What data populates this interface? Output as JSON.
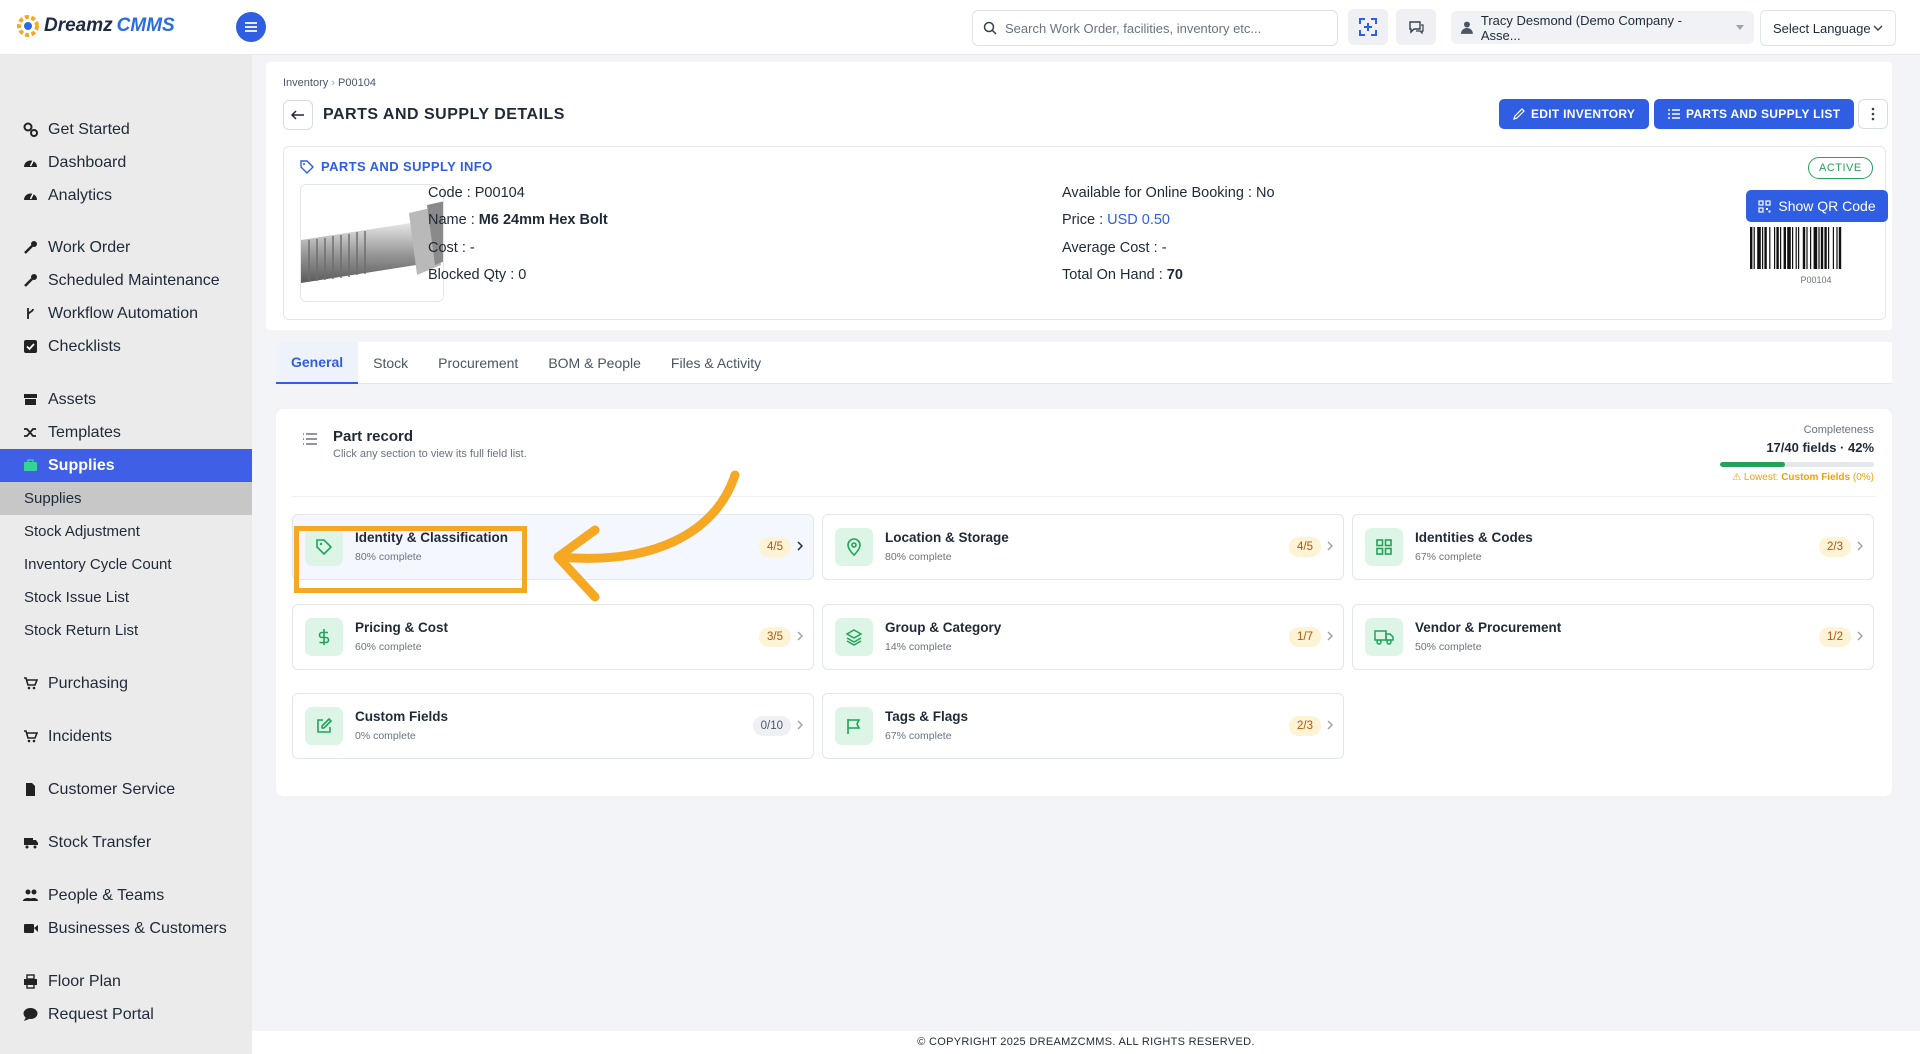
{
  "app": {
    "logo_part1": "Dreamz",
    "logo_part2": "CMMS"
  },
  "header": {
    "search_placeholder": "Search Work Order, facilities, inventory etc...",
    "user_name": "Tracy Desmond (Demo Company - Asse...",
    "language_label": "Select Language"
  },
  "sidebar": {
    "items": [
      {
        "label": "Get Started",
        "icon": "gears-icon"
      },
      {
        "label": "Dashboard",
        "icon": "gauge-icon"
      },
      {
        "label": "Analytics",
        "icon": "gauge-icon"
      },
      {
        "label": "Work Order",
        "icon": "wrench-icon"
      },
      {
        "label": "Scheduled Maintenance",
        "icon": "wrench-icon"
      },
      {
        "label": "Workflow Automation",
        "icon": "branch-icon"
      },
      {
        "label": "Checklists",
        "icon": "checkbox-icon"
      },
      {
        "label": "Assets",
        "icon": "archive-icon"
      },
      {
        "label": "Templates",
        "icon": "shuffle-icon"
      },
      {
        "label": "Supplies",
        "icon": "briefcase-icon"
      },
      {
        "label": "Purchasing",
        "icon": "cart-icon"
      },
      {
        "label": "Incidents",
        "icon": "cart-icon"
      },
      {
        "label": "Customer Service",
        "icon": "file-icon"
      },
      {
        "label": "Stock Transfer",
        "icon": "truck-icon"
      },
      {
        "label": "People & Teams",
        "icon": "users-icon"
      },
      {
        "label": "Businesses & Customers",
        "icon": "video-icon"
      },
      {
        "label": "Floor Plan",
        "icon": "printer-icon"
      },
      {
        "label": "Request Portal",
        "icon": "chat-icon"
      }
    ],
    "sub_items": [
      "Supplies",
      "Stock Adjustment",
      "Inventory Cycle Count",
      "Stock Issue List",
      "Stock Return List"
    ]
  },
  "page": {
    "breadcrumb_root": "Inventory",
    "breadcrumb_current": "P00104",
    "title": "PARTS AND SUPPLY DETAILS",
    "edit_button": "EDIT INVENTORY",
    "list_button": "PARTS AND SUPPLY LIST"
  },
  "info": {
    "section_title": "PARTS AND SUPPLY INFO",
    "code_label": "Code :",
    "code_value": "P00104",
    "name_label": "Name :",
    "name_value": "M6 24mm Hex Bolt",
    "cost_label": "Cost :",
    "cost_value": "-",
    "blocked_label": "Blocked Qty :",
    "blocked_value": "0",
    "online_label": "Available for Online Booking :",
    "online_value": "No",
    "price_label": "Price :",
    "price_value": "USD 0.50",
    "avg_label": "Average Cost :",
    "avg_value": "-",
    "onhand_label": "Total On Hand :",
    "onhand_value": "70",
    "status": "ACTIVE",
    "qr_button": "Show QR Code",
    "barcode_text": "P00104"
  },
  "tabs": [
    "General",
    "Stock",
    "Procurement",
    "BOM & People",
    "Files & Activity"
  ],
  "record": {
    "title": "Part record",
    "subtitle": "Click any section to view its full field list.",
    "completeness_label": "Completeness",
    "completeness_value": "17/40 fields · 42%",
    "completeness_pct": 42,
    "lowest_prefix": "⚠ Lowest:",
    "lowest_name": "Custom Fields",
    "lowest_pct": "(0%)",
    "sections": [
      {
        "name": "Identity & Classification",
        "pct": "80% complete",
        "count": "4/5",
        "icon": "tag-icon"
      },
      {
        "name": "Location & Storage",
        "pct": "80% complete",
        "count": "4/5",
        "icon": "map-pin-icon"
      },
      {
        "name": "Identities & Codes",
        "pct": "67% complete",
        "count": "2/3",
        "icon": "grid-icon"
      },
      {
        "name": "Pricing & Cost",
        "pct": "60% complete",
        "count": "3/5",
        "icon": "dollar-icon"
      },
      {
        "name": "Group & Category",
        "pct": "14% complete",
        "count": "1/7",
        "icon": "layers-icon"
      },
      {
        "name": "Vendor & Procurement",
        "pct": "50% complete",
        "count": "1/2",
        "icon": "truck-icon"
      },
      {
        "name": "Custom Fields",
        "pct": "0% complete",
        "count": "0/10",
        "icon": "edit-icon"
      },
      {
        "name": "Tags & Flags",
        "pct": "67% complete",
        "count": "2/3",
        "icon": "flag-icon"
      }
    ]
  },
  "footer": "© COPYRIGHT 2025 DREAMZCMMS. ALL RIGHTS RESERVED.",
  "colors": {
    "primary": "#2f5ee3",
    "success": "#22a35a",
    "warning": "#f7a823",
    "sidebar_active": "#3f60e6"
  }
}
